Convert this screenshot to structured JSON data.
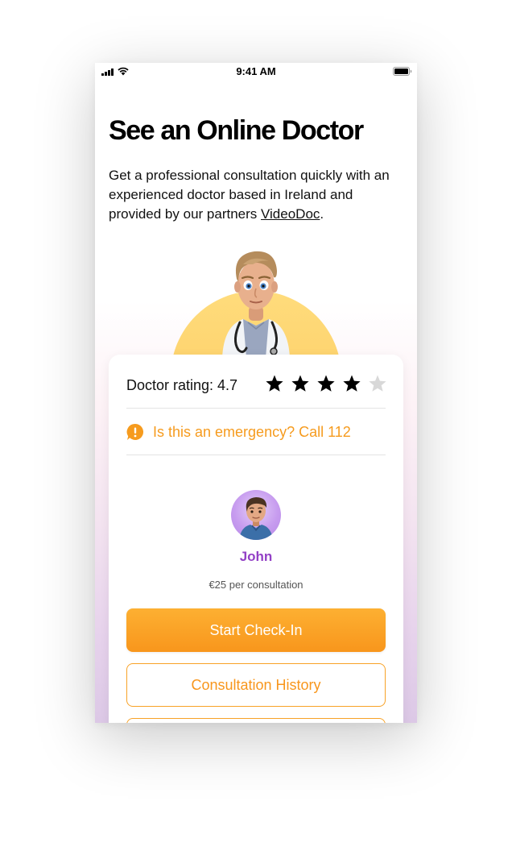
{
  "status_bar": {
    "time": "9:41 AM"
  },
  "header": {
    "title": "See an Online Doctor",
    "intro_text": "Get a professional consultation quickly with an experienced doctor based in Ireland and provided by our partners ",
    "partner_link": "VideoDoc",
    "intro_end": "."
  },
  "rating": {
    "label": "Doctor rating: 4.7",
    "stars_value": 4,
    "stars_total": 5,
    "filled_color": "#000000",
    "empty_color": "#d8d8d8"
  },
  "emergency": {
    "text": "Is this an emergency? Call 112",
    "color": "#f69b1e"
  },
  "doctor": {
    "name": "John",
    "price": "€25 per consultation",
    "name_color": "#9341c6"
  },
  "actions": {
    "start_checkin": "Start Check-In",
    "consultation_history": "Consultation History"
  },
  "colors": {
    "accent_orange": "#f8961c",
    "sun_yellow": "#fcc95e"
  }
}
